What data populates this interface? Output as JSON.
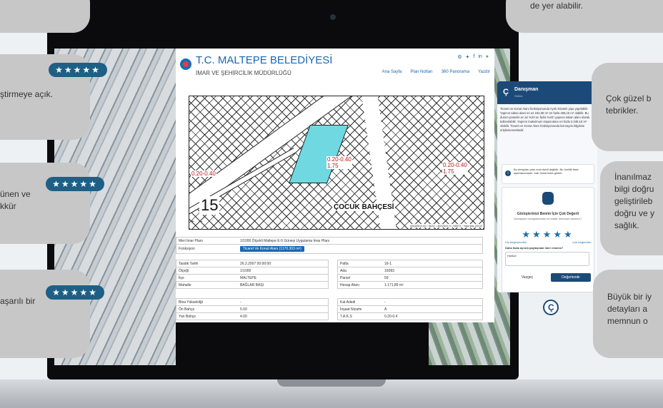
{
  "cards": {
    "left": [
      {
        "text_lines": [
          "ştirmeye açık."
        ],
        "stars": "★★★★★"
      },
      {
        "text_lines": [
          "ünen ve",
          "kkür"
        ],
        "stars": "★★★★★"
      },
      {
        "text_lines": [
          "aşarılı bir"
        ],
        "stars": "★★★★★"
      }
    ],
    "right": [
      {
        "text_lines": [
          "de yer alabilir."
        ]
      },
      {
        "text_lines": [
          "Çok güzel b",
          "tebrikler."
        ]
      },
      {
        "text_lines": [
          "İnanılmaz",
          "bilgi doğru",
          "geliştirileb",
          "doğru ve y",
          "sağlık."
        ]
      },
      {
        "text_lines": [
          "Büyük bir iy",
          "detayları a",
          "memnun o"
        ]
      }
    ]
  },
  "site": {
    "brand": "T.C. MALTEPE BELEDİYESİ",
    "department": "İMAR VE ŞEHİRCİLİK MÜDÜRLÜĞÜ",
    "nav": [
      "Ana Sayfa",
      "Plan Notları",
      "360 Panorama",
      "Yazdır"
    ],
    "map": {
      "label_plot": "0.20-0.40\n1.75",
      "label_right": "0.20-0.40\n1.75",
      "label_left": "0.20-0.40",
      "park": "ÇOCUK BAHÇESİ",
      "scale_number": "15",
      "zoom_in": "+",
      "zoom_out": "−",
      "coords": "(4632504.00 / 4632 / 4632504.0 / 08572 / Yakınlaş 2022)"
    },
    "plan": {
      "label": "Meri İmar Planı",
      "value": "1/1000 Ölçekli Maltepe E-5 Güneyi Uygulama İmar Planı"
    },
    "function": {
      "label": "Fonksiyon",
      "value": "Ticaret Ve Konut Alanı (1170.303 m²)"
    },
    "details_left": [
      {
        "label": "Tasdik Tarihi",
        "value": "26.2.2007 00:00:00"
      },
      {
        "label": "Ölçeği",
        "value": "1/1000"
      },
      {
        "label": "İlçe",
        "value": "MALTEPE"
      },
      {
        "label": "Mahalle",
        "value": "BAĞLAR BAŞI"
      }
    ],
    "details_right": [
      {
        "label": "Pafta",
        "value": "16-1"
      },
      {
        "label": "Ada",
        "value": "16083"
      },
      {
        "label": "Parsel",
        "value": "59"
      },
      {
        "label": "Hesap Alanı",
        "value": "1.171,89 m²"
      }
    ],
    "building_left": [
      {
        "label": "Bina Yüksekliği",
        "value": "-"
      },
      {
        "label": "Ön Bahçe",
        "value": "5.00"
      },
      {
        "label": "Yan Bahçe",
        "value": "4.00"
      }
    ],
    "building_right": [
      {
        "label": "Kat Adedi",
        "value": "-"
      },
      {
        "label": "İnşaat Nizamı",
        "value": "A"
      },
      {
        "label": "T.A.K.S",
        "value": "0.20-0.4"
      }
    ]
  },
  "chat": {
    "title": "Danışman",
    "subtitle": "Online",
    "body": "Ticaret ve Konut Alanı fonksiyonunda Ayrık Nizamlı yapı yapılabilir. Yapının taban alanı en az 234,08 m² en fazla 468,15 m² olabilir. Bu durum parselin en az %20 en fazla %40'ı yapının taban alanı olarak kullanılabilir. Yapının maksimum inşaat alanı en fazla 2.048,15 m² olabilir. Ticaret ve Konut Alanı fonksiyonunda kat sayısı bilgisine erişilememektedir.",
    "note": "Bu detayları plan notu dahil değildir. Bu özellik beta aşamasındadır. Kalı Daha fazla göster",
    "rating_title": "Görüşlerinizi Benim İçin Çok Değerli",
    "rating_sub": "Danışman cevaplarından ne kadar memnun kaldınız?",
    "rating_stars": "★★★★★",
    "low_label": "Hiç beğenmedim",
    "high_label": "Çok beğendim",
    "question": "Daha fazla ayrıntı paylaşmak ister misiniz?",
    "answer": "Harika!",
    "cancel": "Vazgeç",
    "submit": "Değerlendir"
  }
}
